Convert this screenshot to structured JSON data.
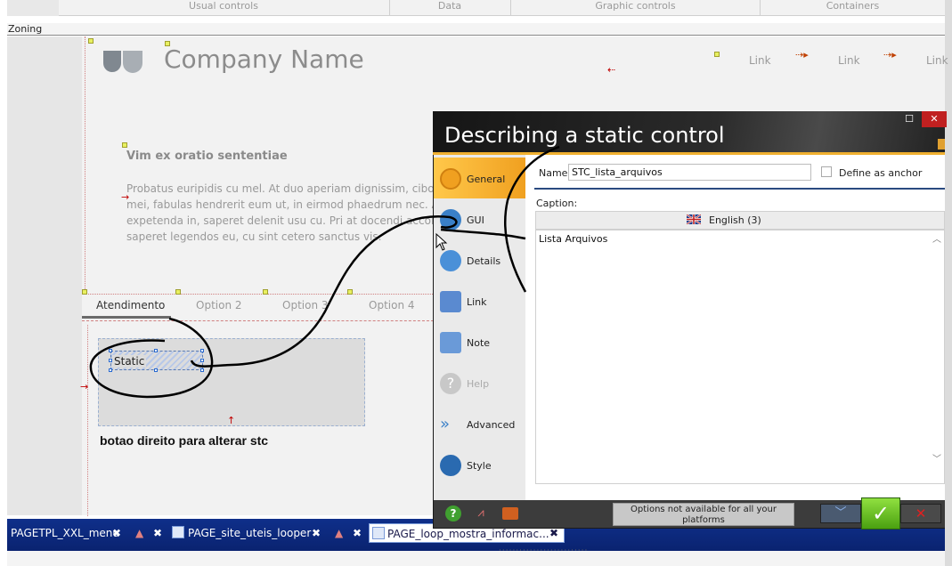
{
  "ribbon": {
    "sections": [
      "Usual controls",
      "Data",
      "Graphic controls",
      "Containers"
    ]
  },
  "zoning": {
    "label": "Zoning"
  },
  "page": {
    "company_name": "Company Name",
    "links": [
      "Link",
      "Link",
      "Link"
    ],
    "heading": "Vim ex oratio sententiae",
    "paragraph_lines": [
      "Probatus euripidis cu mel. At duo aperiam dignissim, cibo pr",
      "mei, fabulas hendrerit eum ut, in eirmod phaedrum nec. A",
      "expetenda in, saperet delenit usu cu. Pri at docendi accor",
      "saperet legendos eu, cu sint cetero sanctus vis."
    ],
    "tabs": [
      "Atendimento",
      "Option 2",
      "Option 3",
      "Option 4"
    ],
    "active_tab": "Atendimento",
    "static_label": "Static",
    "hint": "botao direito para alterar stc"
  },
  "dialog": {
    "title": "Describing a static control",
    "nav": [
      {
        "label": "General",
        "icon": "general-icon",
        "active": true
      },
      {
        "label": "GUI",
        "icon": "gui-icon",
        "active": false
      },
      {
        "label": "Details",
        "icon": "details-icon",
        "active": false
      },
      {
        "label": "Link",
        "icon": "link-icon",
        "active": false
      },
      {
        "label": "Note",
        "icon": "note-icon",
        "active": false
      },
      {
        "label": "Help",
        "icon": "help-icon",
        "active": false,
        "disabled": true
      },
      {
        "label": "Advanced",
        "icon": "advanced-icon",
        "active": false
      },
      {
        "label": "Style",
        "icon": "style-icon",
        "active": false
      }
    ],
    "name_label": "Name:",
    "name_value": "STC_lista_arquivos",
    "anchor_label": "Define as anchor",
    "caption_label": "Caption:",
    "language": "English (3)",
    "caption_value": "Lista Arquivos",
    "notice_line1": "Options not available for all your",
    "notice_line2": "platforms",
    "colors": {
      "accent": "#f0a020",
      "ok": "#5cc020",
      "cancel": "#d02020"
    }
  },
  "taskbar": {
    "items": [
      "PAGETPL_XXL_menu",
      "PAGE_site_uteis_looper",
      "PAGE_loop_mostra_informac..."
    ],
    "active_item": "PAGE_loop_mostra_informac..."
  }
}
